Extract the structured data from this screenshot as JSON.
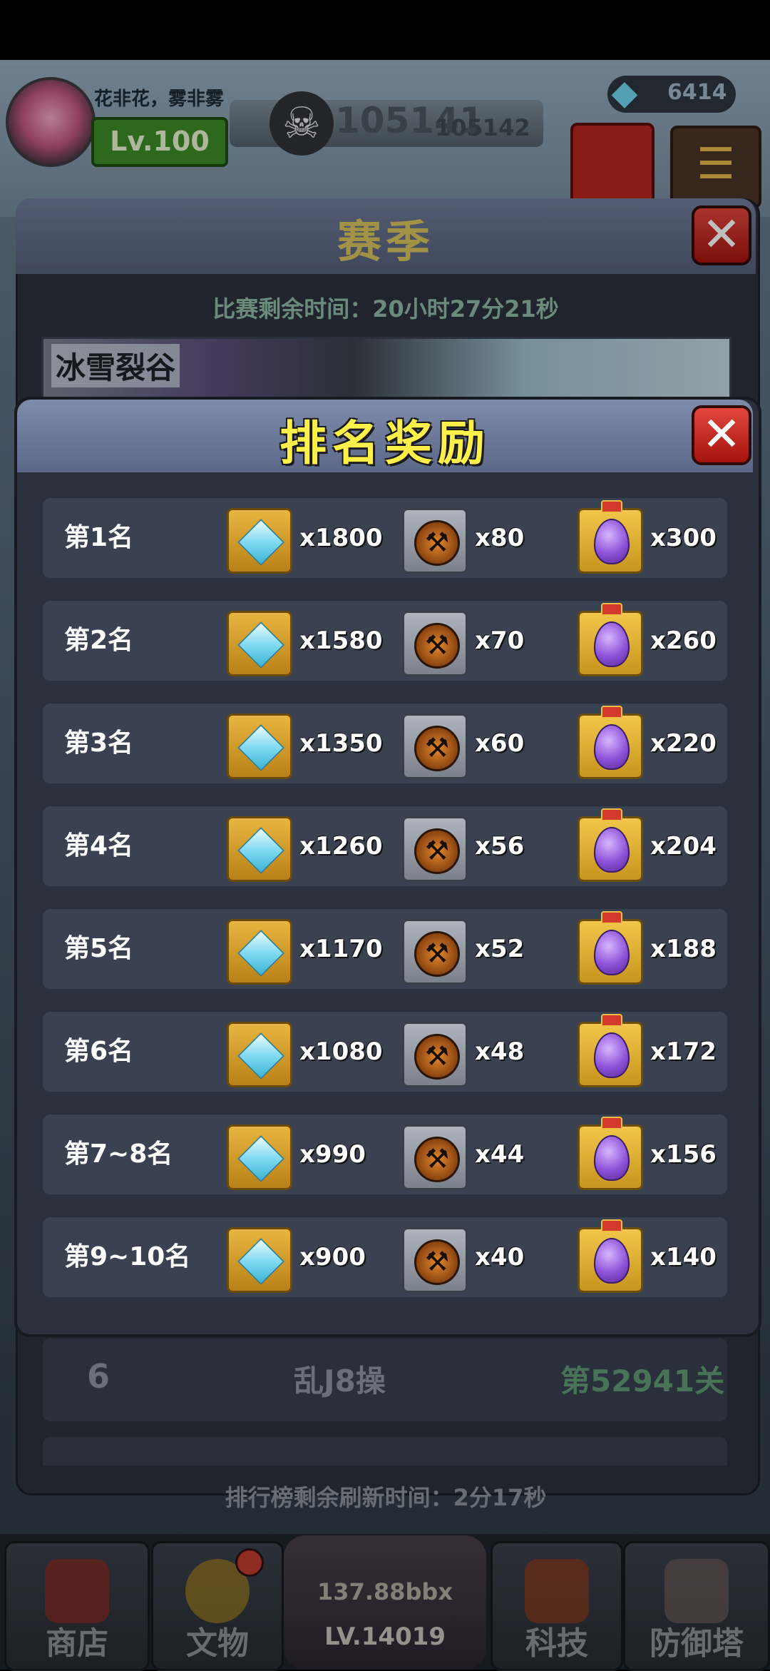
{
  "hud": {
    "player_name": "花非花，雾非雾",
    "level": "Lv.100",
    "score_main": "105141",
    "score_sub": "105142",
    "gem_count": "6414"
  },
  "season": {
    "title": "赛季",
    "close_label": "✕",
    "timer": "比赛剩余时间：20小时27分21秒",
    "map_name": "冰雪裂谷"
  },
  "leaderboard": {
    "row": {
      "rank": "6",
      "name": "乱J8操",
      "stage": "第52941关"
    },
    "refresh_timer": "排行榜剩余刷新时间：2分17秒"
  },
  "bottom_nav": {
    "shop": "商店",
    "relic": "文物",
    "center_value": "137.88bbx",
    "center_level": "LV.14019",
    "tech": "科技",
    "tower": "防御塔"
  },
  "reward_modal": {
    "title": "排名奖励",
    "close_label": "✕",
    "rows": [
      {
        "rank": "第1名",
        "gem": "x1800",
        "pick": "x80",
        "egg": "x300"
      },
      {
        "rank": "第2名",
        "gem": "x1580",
        "pick": "x70",
        "egg": "x260"
      },
      {
        "rank": "第3名",
        "gem": "x1350",
        "pick": "x60",
        "egg": "x220"
      },
      {
        "rank": "第4名",
        "gem": "x1260",
        "pick": "x56",
        "egg": "x204"
      },
      {
        "rank": "第5名",
        "gem": "x1170",
        "pick": "x52",
        "egg": "x188"
      },
      {
        "rank": "第6名",
        "gem": "x1080",
        "pick": "x48",
        "egg": "x172"
      },
      {
        "rank": "第7~8名",
        "gem": "x990",
        "pick": "x44",
        "egg": "x156"
      },
      {
        "rank": "第9~10名",
        "gem": "x900",
        "pick": "x40",
        "egg": "x140"
      }
    ]
  },
  "colors": {
    "title_yellow": "#fff04a",
    "season_title_gold": "#d7c35c",
    "close_red": "#d3291f",
    "stage_green": "#5f9a73"
  },
  "icons": {
    "reward_gem": "diamond-icon",
    "reward_pick": "pickaxe-icon",
    "reward_egg": "purple-egg-icon",
    "hud_skull": "skull-icon",
    "hud_gem": "diamond-icon"
  }
}
